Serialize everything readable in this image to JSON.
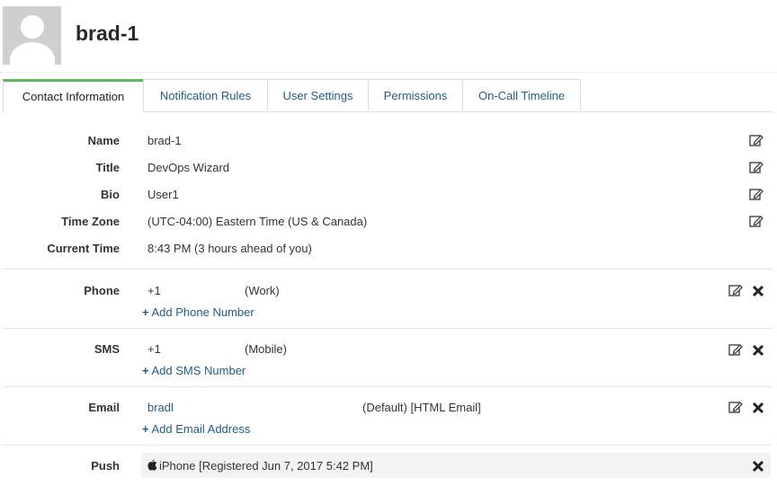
{
  "user": {
    "name": "brad-1"
  },
  "tabs": [
    {
      "label": "Contact Information"
    },
    {
      "label": "Notification Rules"
    },
    {
      "label": "User Settings"
    },
    {
      "label": "Permissions"
    },
    {
      "label": "On-Call Timeline"
    }
  ],
  "profile": {
    "name_label": "Name",
    "name_value": "brad-1",
    "title_label": "Title",
    "title_value": "DevOps Wizard",
    "bio_label": "Bio",
    "bio_value": "User1",
    "timezone_label": "Time Zone",
    "timezone_value": "(UTC-04:00) Eastern Time (US & Canada)",
    "current_time_label": "Current Time",
    "current_time_value": "8:43 PM (3 hours ahead of you)"
  },
  "phone": {
    "label": "Phone",
    "number": "+1",
    "type": "(Work)",
    "add_label": "Add Phone Number"
  },
  "sms": {
    "label": "SMS",
    "number": "+1",
    "type": "(Mobile)",
    "add_label": "Add SMS Number"
  },
  "email": {
    "label": "Email",
    "address": "bradl",
    "tags": "(Default) [HTML Email]",
    "add_label": "Add Email Address"
  },
  "push": {
    "label": "Push",
    "device": "iPhone [Registered Jun 7, 2017 5:42 PM]"
  },
  "colors": {
    "accent_tab": "#5cb85c",
    "link": "#1f5c8f"
  }
}
